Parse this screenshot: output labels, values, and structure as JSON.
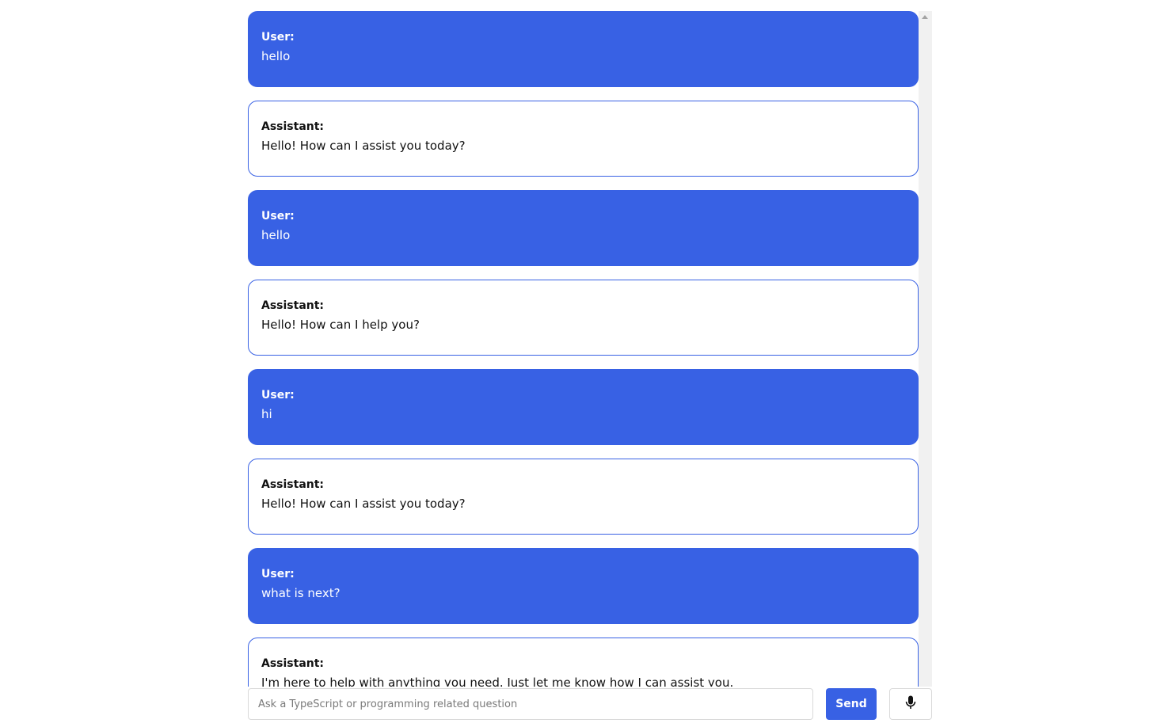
{
  "chat": {
    "messages": [
      {
        "role": "user",
        "label": "User:",
        "text": "hello"
      },
      {
        "role": "assistant",
        "label": "Assistant:",
        "text": "Hello! How can I assist you today?"
      },
      {
        "role": "user",
        "label": "User:",
        "text": "hello"
      },
      {
        "role": "assistant",
        "label": "Assistant:",
        "text": "Hello! How can I help you?"
      },
      {
        "role": "user",
        "label": "User:",
        "text": "hi"
      },
      {
        "role": "assistant",
        "label": "Assistant:",
        "text": "Hello! How can I assist you today?"
      },
      {
        "role": "user",
        "label": "User:",
        "text": "what is next?"
      },
      {
        "role": "assistant",
        "label": "Assistant:",
        "text": "I'm here to help with anything you need. Just let me know how I can assist you."
      }
    ]
  },
  "input": {
    "value": "",
    "placeholder": "Ask a TypeScript or programming related question"
  },
  "buttons": {
    "send_label": "Send",
    "mic_icon": "microphone-icon"
  },
  "colors": {
    "accent": "#3861e4",
    "user_bubble_text": "#ffffff",
    "assistant_bubble_bg": "#ffffff"
  }
}
